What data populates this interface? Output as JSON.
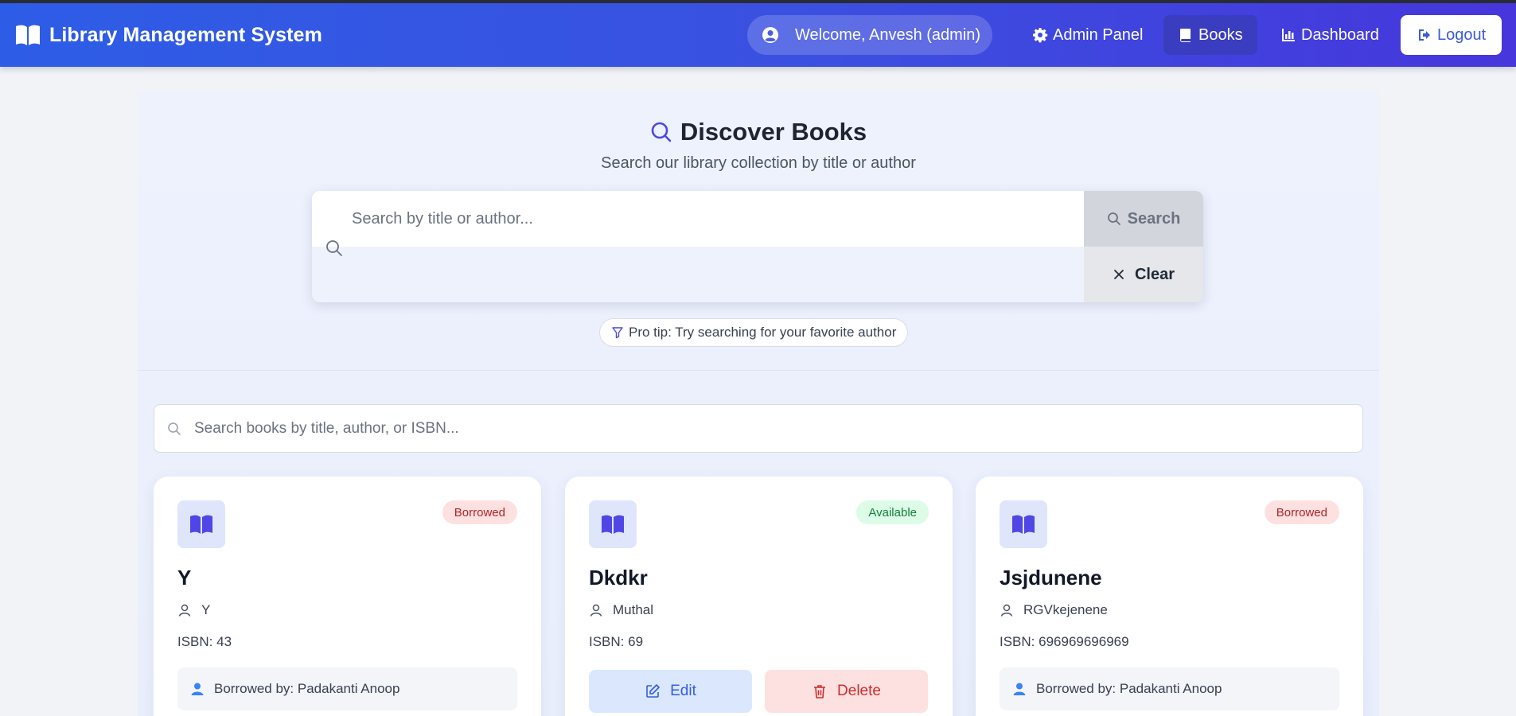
{
  "app": {
    "title": "Library Management System"
  },
  "nav": {
    "welcome": "Welcome, Anvesh (admin)",
    "admin_panel": "Admin Panel",
    "books": "Books",
    "dashboard": "Dashboard",
    "logout": "Logout",
    "active": "Books"
  },
  "hero": {
    "title": "Discover Books",
    "subtitle": "Search our library collection by title or author",
    "search_placeholder": "Search by title or author...",
    "search_button": "Search",
    "clear_button": "Clear",
    "pro_tip": "Pro tip: Try searching for your favorite author"
  },
  "filter": {
    "placeholder": "Search books by title, author, or ISBN..."
  },
  "books": [
    {
      "title": "Y",
      "author": "Y",
      "isbn": "ISBN: 43",
      "status": "Borrowed",
      "borrowed_by": "Borrowed by: Padakanti Anoop"
    },
    {
      "title": "Dkdkr",
      "author": "Muthal",
      "isbn": "ISBN: 69",
      "status": "Available",
      "edit_label": "Edit",
      "delete_label": "Delete"
    },
    {
      "title": "Jsjdunene",
      "author": "RGVkejenene",
      "isbn": "ISBN: 696969696969",
      "status": "Borrowed",
      "borrowed_by": "Borrowed by: Padakanti Anoop"
    }
  ],
  "colors": {
    "nav_gradient_start": "#2d5de6",
    "nav_gradient_end": "#4636dc",
    "accent": "#3b5bdb",
    "borrowed_badge": "#fde1e1",
    "available_badge": "#dcfce7"
  },
  "icons": [
    "book-open-icon",
    "user-circle-icon",
    "gear-icon",
    "book-icon",
    "chart-icon",
    "logout-icon",
    "search-icon",
    "close-icon",
    "filter-icon",
    "user-icon",
    "edit-icon",
    "trash-icon"
  ]
}
